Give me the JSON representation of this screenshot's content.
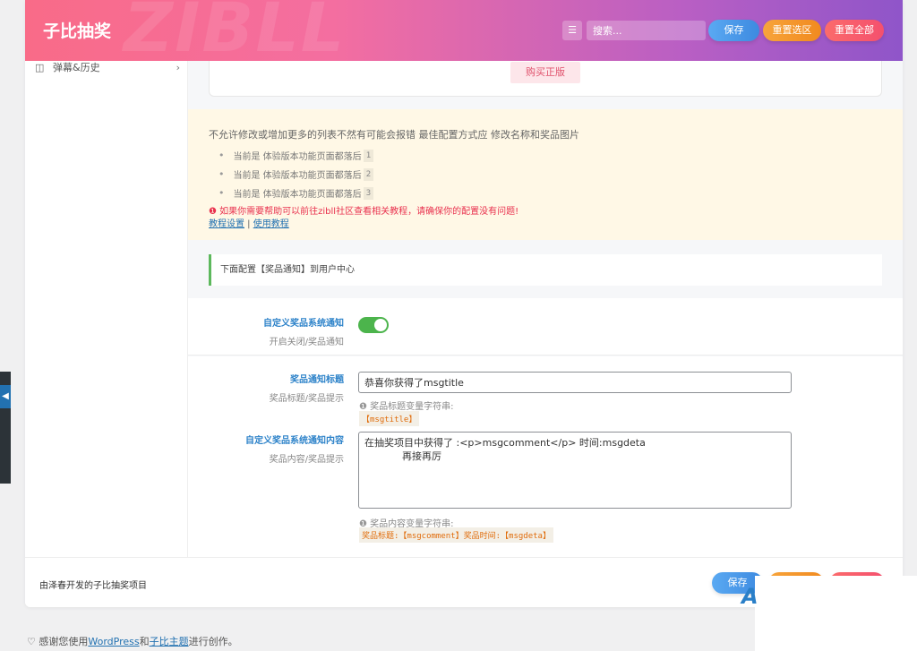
{
  "header": {
    "title": "子比抽奖",
    "watermark": "ZIBLL",
    "menu_icon": "list-icon",
    "search_placeholder": "搜索...",
    "save_label": "保存",
    "reset_section_label": "重置选区",
    "reset_all_label": "重置全部"
  },
  "sidebar": {
    "items": [
      {
        "icon": "book-icon",
        "label": "弹幕&历史"
      }
    ]
  },
  "top_card": {
    "buy_label": "购买正版"
  },
  "notice": {
    "title": "不允许修改或增加更多的列表不然有可能会报错 最佳配置方式应 修改名称和奖品图片",
    "items": [
      {
        "text": "当前是 体验版本功能页面都落后",
        "num": "1"
      },
      {
        "text": "当前是 体验版本功能页面都落后",
        "num": "2"
      },
      {
        "text": "当前是 体验版本功能页面都落后",
        "num": "3"
      }
    ],
    "warning": "如果你需要帮助可以前往zibll社区查看相关教程，请确保你的配置没有问题!",
    "link1": "教程设置",
    "separator": " | ",
    "link2": "使用教程"
  },
  "section": {
    "heading": "下面配置【奖品通知】到用户中心"
  },
  "fields": {
    "notify": {
      "title": "自定义奖品系统通知",
      "subtitle": "开启关闭/奖品通知",
      "enabled": true
    },
    "notify_title": {
      "title": "奖品通知标题",
      "subtitle": "奖品标题/奖品提示",
      "value": "恭喜你获得了msgtitle",
      "hint": "奖品标题变量字符串:",
      "code": "【msgtitle】"
    },
    "notify_content": {
      "title": "自定义奖品系统通知内容",
      "subtitle": "奖品内容/奖品提示",
      "value": "在抽奖项目中获得了 :<p>msgcomment</p> 时间:msgdeta\n            再接再厉",
      "hint": "奖品内容变量字符串:",
      "code": "奖品标题:【msgcomment】奖品时间:【msgdeta】"
    }
  },
  "footer": {
    "credit": "由泽春开发的子比抽奖项目",
    "save_label": "保存"
  },
  "wp_footer": {
    "prefix": "感谢您使用",
    "wordpress": "WordPress",
    "and": "和",
    "theme": "子比主题",
    "suffix": "进行创作。"
  },
  "colors": {
    "header_start": "#f96b88",
    "header_end": "#8f55c9",
    "accent_blue": "#2c82c9",
    "toggle_on": "#4cb44c",
    "warning_red": "#e9314e",
    "section_border": "#5cb85c"
  }
}
